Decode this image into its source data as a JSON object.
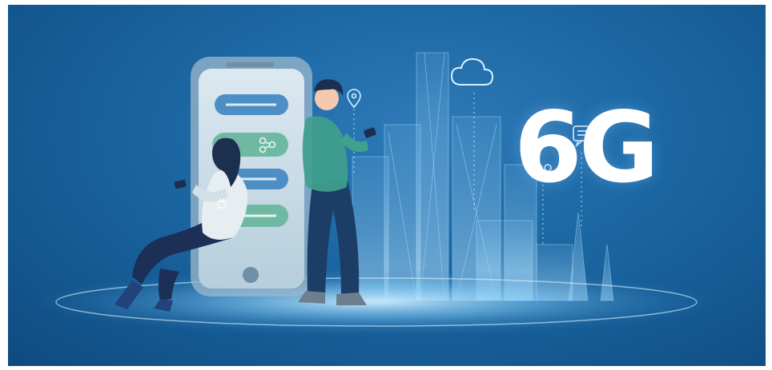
{
  "scene": {
    "description_hidden": false,
    "headline": "6G",
    "colors": {
      "background": "#1d6aa6",
      "background_dark": "#0f4a80",
      "glow": "#9fd7ff",
      "phone_screen": "#d8e6ee",
      "bubble_blue": "#4d8fc4",
      "bubble_green": "#6fb9a3",
      "man_shirt": "#3fa08c",
      "man_pants": "#1c3d66",
      "woman_top": "#e6eef2",
      "woman_pants": "#1b2f57",
      "hair": "#1c2f4f"
    },
    "icons": [
      "cloud-icon",
      "location-pin-icon",
      "chat-bubble-icon",
      "user-group-icon",
      "share-icon",
      "power-plug-icon"
    ]
  }
}
